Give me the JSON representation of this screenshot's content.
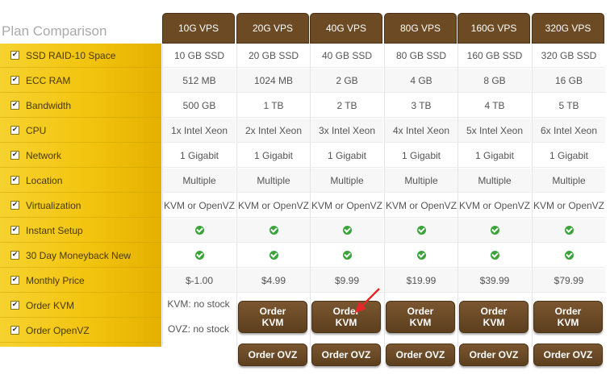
{
  "title": "Plan Comparison",
  "features": [
    "SSD RAID-10 Space",
    "ECC RAM",
    "Bandwidth",
    "CPU",
    "Network",
    "Location",
    "Virtualization",
    "Instant Setup",
    "30 Day Moneyback New",
    "Monthly Price",
    "Order KVM",
    "Order OpenVZ"
  ],
  "plans": [
    {
      "name": "10G VPS",
      "ssd": "10 GB SSD",
      "ram": "512 MB",
      "bw": "500 GB",
      "cpu": "1x Intel Xeon",
      "net": "1 Gigabit",
      "loc": "Multiple",
      "virt": "KVM or OpenVZ",
      "price": "$-1.00",
      "kvm": "KVM: no stock",
      "ovz": "OVZ: no stock"
    },
    {
      "name": "20G VPS",
      "ssd": "20 GB SSD",
      "ram": "1024 MB",
      "bw": "1 TB",
      "cpu": "2x Intel Xeon",
      "net": "1 Gigabit",
      "loc": "Multiple",
      "virt": "KVM or OpenVZ",
      "price": "$4.99",
      "kvm": "Order KVM",
      "ovz": "Order OVZ"
    },
    {
      "name": "40G VPS",
      "ssd": "40 GB SSD",
      "ram": "2 GB",
      "bw": "2 TB",
      "cpu": "3x Intel Xeon",
      "net": "1 Gigabit",
      "loc": "Multiple",
      "virt": "KVM or OpenVZ",
      "price": "$9.99",
      "kvm": "Order KVM",
      "ovz": "Order OVZ"
    },
    {
      "name": "80G VPS",
      "ssd": "80 GB SSD",
      "ram": "4 GB",
      "bw": "3 TB",
      "cpu": "4x Intel Xeon",
      "net": "1 Gigabit",
      "loc": "Multiple",
      "virt": "KVM or OpenVZ",
      "price": "$19.99",
      "kvm": "Order KVM",
      "ovz": "Order OVZ"
    },
    {
      "name": "160G VPS",
      "ssd": "160 GB SSD",
      "ram": "8 GB",
      "bw": "4 TB",
      "cpu": "5x Intel Xeon",
      "net": "1 Gigabit",
      "loc": "Multiple",
      "virt": "KVM or OpenVZ",
      "price": "$39.99",
      "kvm": "Order KVM",
      "ovz": "Order OVZ"
    },
    {
      "name": "320G VPS",
      "ssd": "320 GB SSD",
      "ram": "16 GB",
      "bw": "5 TB",
      "cpu": "6x Intel Xeon",
      "net": "1 Gigabit",
      "loc": "Multiple",
      "virt": "KVM or OpenVZ",
      "price": "$79.99",
      "kvm": "Order KVM",
      "ovz": "Order OVZ"
    }
  ],
  "colors": {
    "header": "#6b4a24",
    "feature_panel": "#f2c40f",
    "check": "#3aa33a",
    "annotation_arrow": "#e8262a"
  }
}
